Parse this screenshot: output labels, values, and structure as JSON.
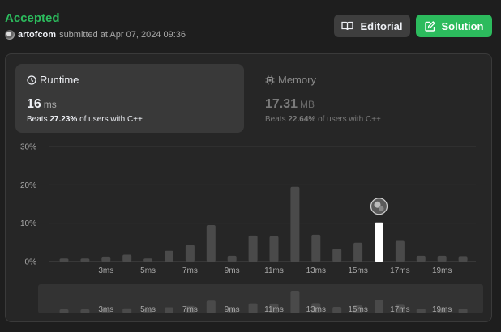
{
  "header": {
    "status": "Accepted",
    "username": "artofcom",
    "submitted_text": "submitted at Apr 07, 2024 09:36"
  },
  "buttons": {
    "editorial_label": "Editorial",
    "solution_label": "Solution"
  },
  "runtime": {
    "label": "Runtime",
    "value": "16",
    "unit": "ms",
    "beats_prefix": "Beats",
    "beats_pct": "27.23%",
    "beats_suffix": "of users with C++"
  },
  "memory": {
    "label": "Memory",
    "value": "17.31",
    "unit": "MB",
    "beats_prefix": "Beats",
    "beats_pct": "22.64%",
    "beats_suffix": "of users with C++"
  },
  "colors": {
    "accepted": "#2cbb5d",
    "bar": "#4a4a4a",
    "highlight_bar": "#ffffff"
  },
  "chart_data": {
    "type": "bar",
    "x": [
      1,
      2,
      3,
      4,
      5,
      6,
      7,
      8,
      9,
      10,
      11,
      12,
      13,
      14,
      15,
      16,
      17,
      18,
      19,
      20
    ],
    "values": [
      0.8,
      0.8,
      1.3,
      1.8,
      0.8,
      2.8,
      4.3,
      9.5,
      1.5,
      6.8,
      6.6,
      19.5,
      7.0,
      3.3,
      4.9,
      10.2,
      5.4,
      1.5,
      1.5,
      1.4
    ],
    "highlight_index": 15,
    "y_ticks": [
      "0%",
      "10%",
      "20%",
      "30%"
    ],
    "ylim": [
      0,
      30
    ],
    "x_tick_labels": [
      "3ms",
      "5ms",
      "7ms",
      "9ms",
      "11ms",
      "13ms",
      "15ms",
      "17ms",
      "19ms"
    ],
    "grid": true
  }
}
